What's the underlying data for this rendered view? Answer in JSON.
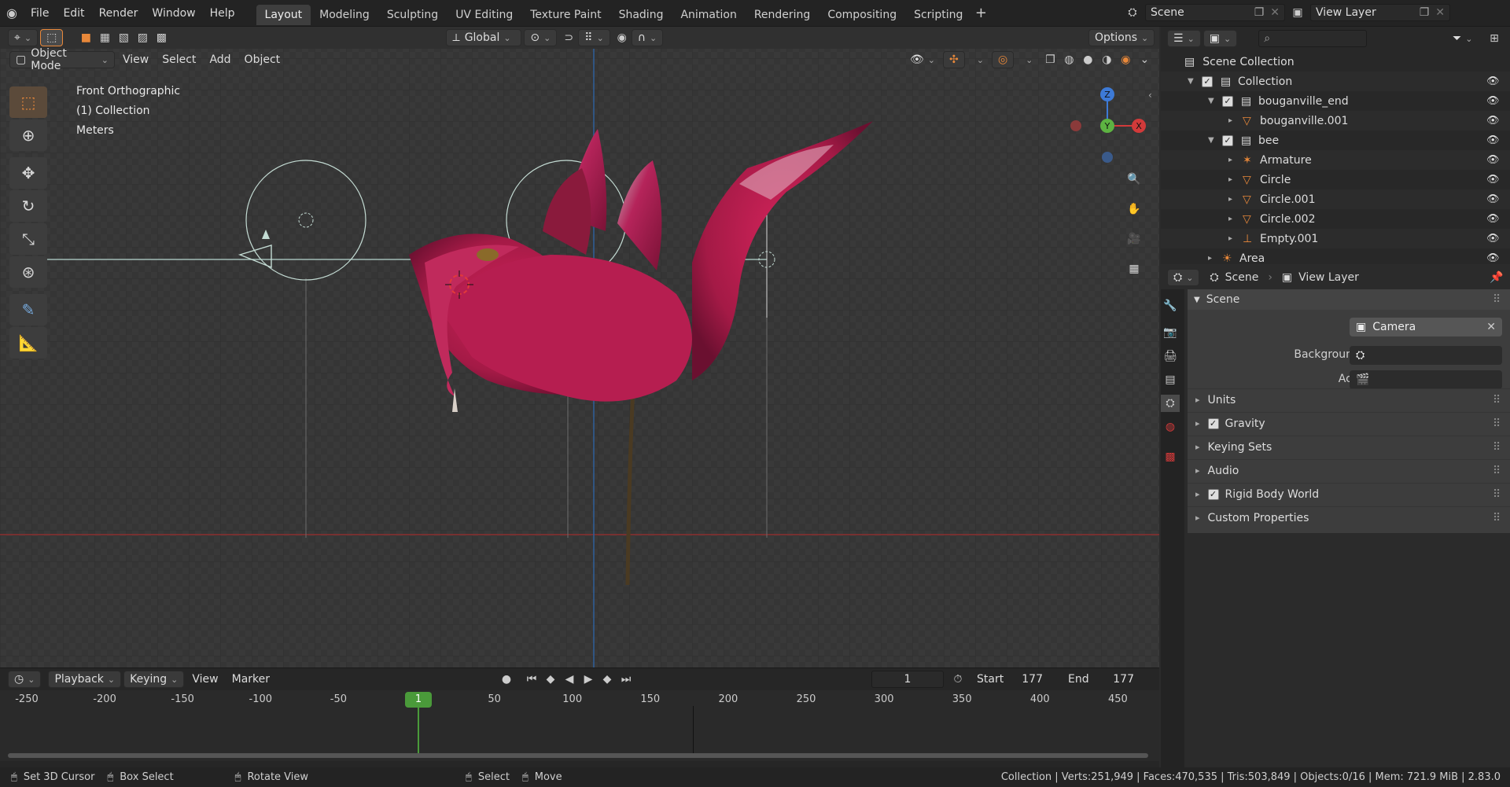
{
  "topbar": {
    "menus": [
      "File",
      "Edit",
      "Render",
      "Window",
      "Help"
    ],
    "workspaces": [
      "Layout",
      "Modeling",
      "Sculpting",
      "UV Editing",
      "Texture Paint",
      "Shading",
      "Animation",
      "Rendering",
      "Compositing",
      "Scripting"
    ],
    "active_workspace": "Layout",
    "scene_name": "Scene",
    "view_layer_name": "View Layer"
  },
  "tool_header": {
    "orientation": "Global",
    "options_label": "Options"
  },
  "viewport_header": {
    "mode": "Object Mode",
    "menus": [
      "View",
      "Select",
      "Add",
      "Object"
    ]
  },
  "viewport_overlay": {
    "view_name": "Front Orthographic",
    "collection_info": "(1) Collection",
    "units": "Meters"
  },
  "gizmo": {
    "z": "Z",
    "y": "Y",
    "x": "X"
  },
  "timeline": {
    "menus": [
      "Playback",
      "Keying",
      "View",
      "Marker"
    ],
    "current_frame": "1",
    "start_label": "Start",
    "start": "177",
    "end_label": "End",
    "end": "177",
    "ruler": [
      "-250",
      "-200",
      "-150",
      "-100",
      "-50",
      "1",
      "50",
      "100",
      "150",
      "200",
      "250",
      "300",
      "350",
      "400",
      "450"
    ]
  },
  "statusbar": {
    "hints": [
      "Set 3D Cursor",
      "Box Select",
      "Rotate View",
      "Select",
      "Move"
    ],
    "stats": "Collection | Verts:251,949 | Faces:470,535 | Tris:503,849 | Objects:0/16 | Mem: 721.9 MiB | 2.83.0"
  },
  "outliner": {
    "root": "Scene Collection",
    "items": [
      {
        "label": "Collection",
        "depth": 0,
        "type": "collection"
      },
      {
        "label": "bouganville_end",
        "depth": 1,
        "type": "collection"
      },
      {
        "label": "bouganville.001",
        "depth": 2,
        "type": "mesh"
      },
      {
        "label": "bee",
        "depth": 1,
        "type": "collection"
      },
      {
        "label": "Armature",
        "depth": 2,
        "type": "armature"
      },
      {
        "label": "Circle",
        "depth": 2,
        "type": "mesh"
      },
      {
        "label": "Circle.001",
        "depth": 2,
        "type": "mesh"
      },
      {
        "label": "Circle.002",
        "depth": 2,
        "type": "mesh"
      },
      {
        "label": "Empty.001",
        "depth": 2,
        "type": "empty"
      },
      {
        "label": "Area",
        "depth": 1,
        "type": "light"
      }
    ]
  },
  "properties": {
    "breadcrumb_scene": "Scene",
    "breadcrumb_layer": "View Layer",
    "section_title": "Scene",
    "camera_label": "Camera",
    "camera_value": "Camera",
    "background_scene_label": "Background Scene",
    "active_clip_label": "Active Clip",
    "panels": [
      {
        "label": "Units",
        "checkbox": false
      },
      {
        "label": "Gravity",
        "checkbox": true
      },
      {
        "label": "Keying Sets",
        "checkbox": false
      },
      {
        "label": "Audio",
        "checkbox": false
      },
      {
        "label": "Rigid Body World",
        "checkbox": true
      },
      {
        "label": "Custom Properties",
        "checkbox": false
      }
    ]
  },
  "colors": {
    "accent_orange": "#e8883a",
    "x_axis": "#d23a3a",
    "y_axis": "#5db342",
    "z_axis": "#3d7ad6",
    "frame_marker": "#4a9a3a",
    "petal": "#b01e4e"
  }
}
